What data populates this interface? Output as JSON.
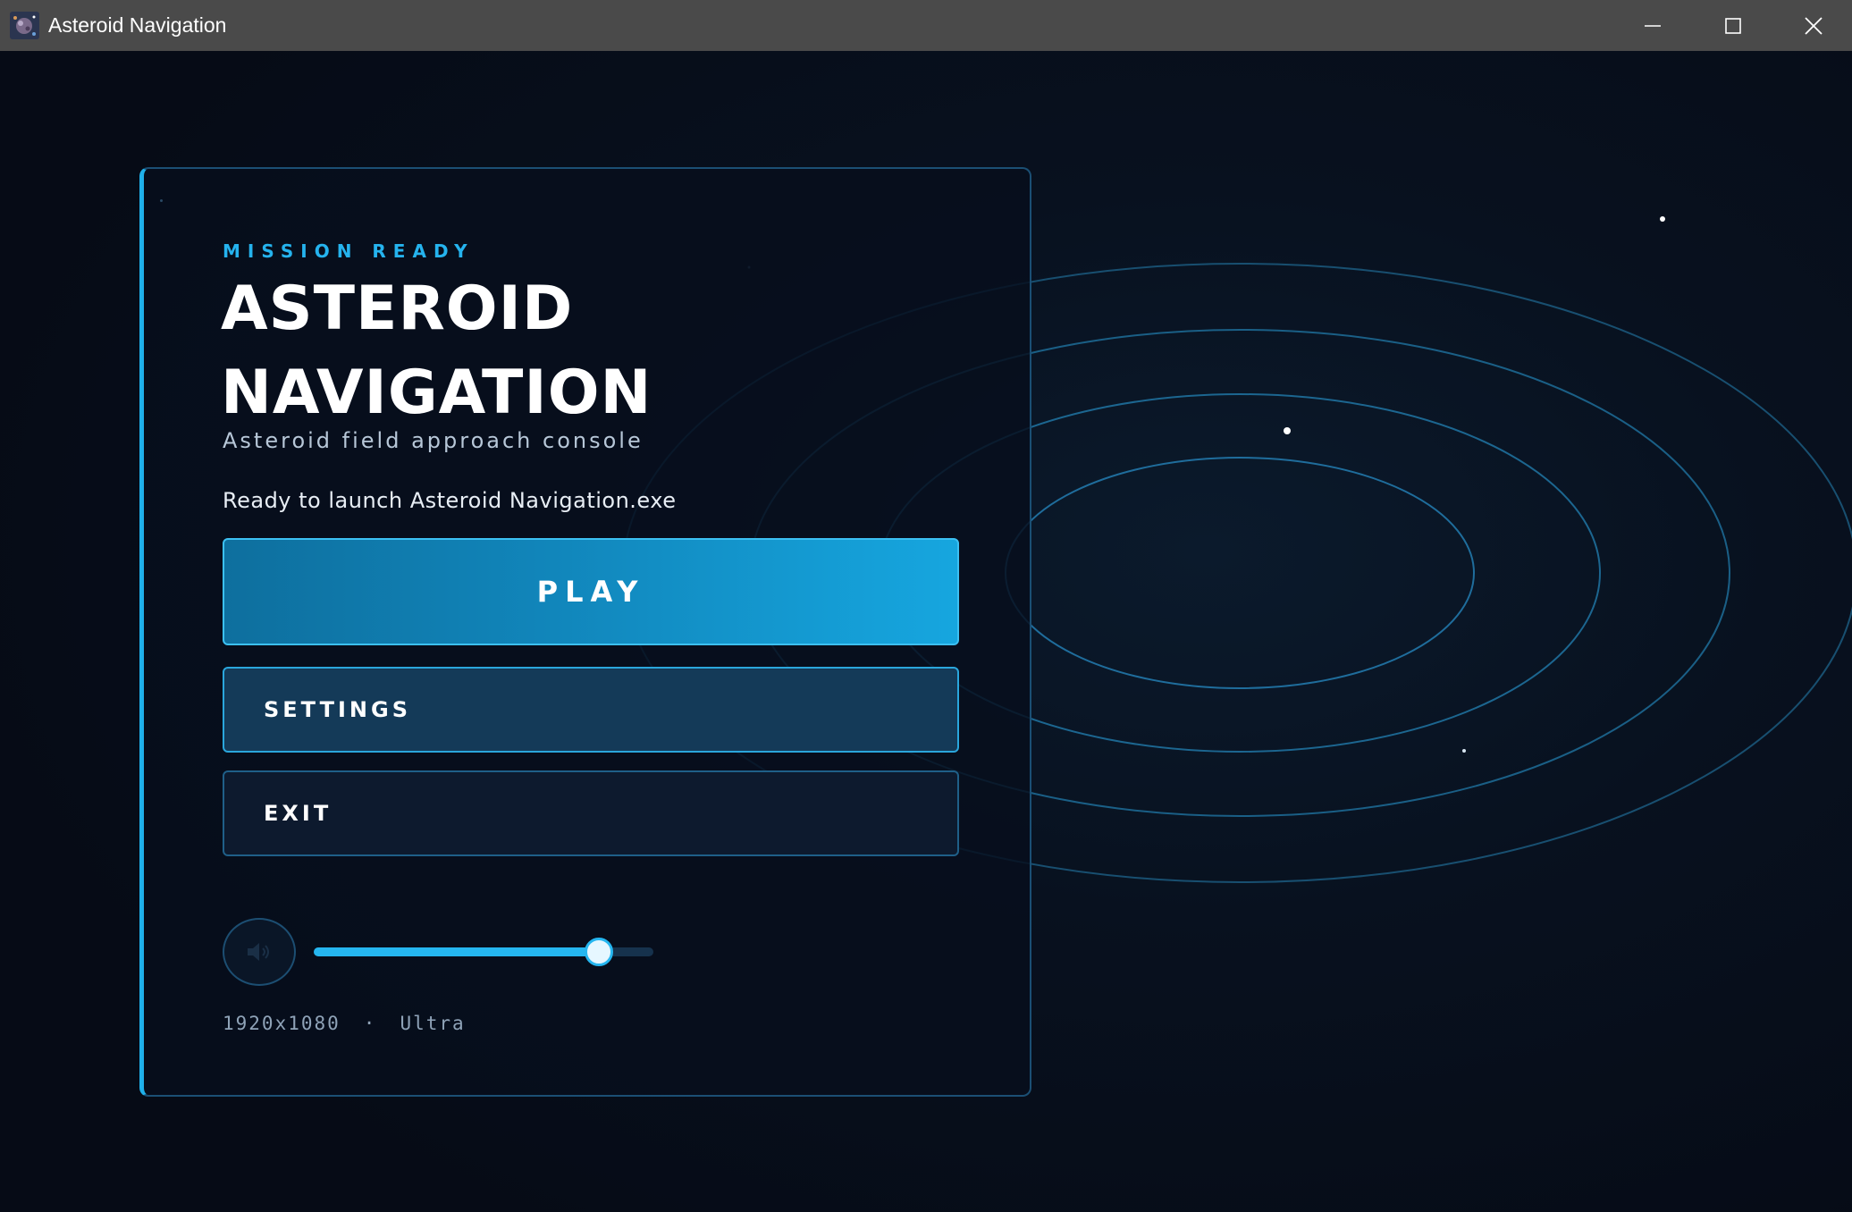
{
  "window": {
    "title": "Asteroid Navigation",
    "icon": "asteroid-app-icon"
  },
  "window_controls": {
    "minimize_icon": "minimize-icon",
    "maximize_icon": "maximize-icon",
    "close_icon": "close-icon"
  },
  "menu": {
    "kicker": "MISSION READY",
    "title": "ASTEROID NAVIGATION",
    "subtitle": "Asteroid field approach console",
    "status": "Ready to launch Asteroid Navigation.exe",
    "buttons": {
      "play": "PLAY",
      "settings": "SETTINGS",
      "exit": "EXIT"
    }
  },
  "audio": {
    "mute_icon": "speaker-icon",
    "volume_fraction": 0.84
  },
  "display": {
    "resolution": "1920x1080",
    "separator": "·",
    "quality": "Ultra"
  },
  "colors": {
    "accent": "#25b3ee",
    "play_button": "#1186bb",
    "settings_button": "#143a58",
    "exit_button": "#0d1a2e",
    "background": "#070d1a",
    "titlebar": "#4a4a4a"
  }
}
